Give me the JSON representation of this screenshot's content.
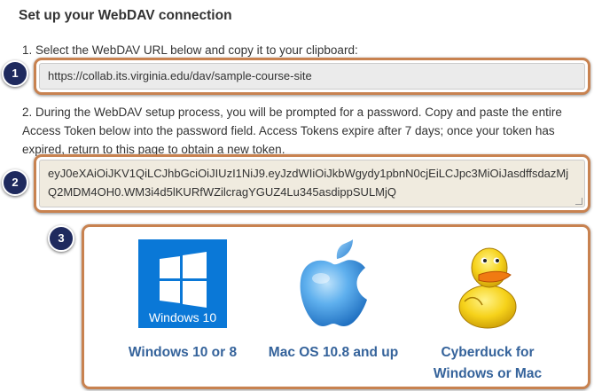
{
  "heading": "Set up your WebDAV connection",
  "step1": {
    "text": "1. Select the WebDAV URL below and copy it to your clipboard:",
    "url_value": "https://collab.its.virginia.edu/dav/sample-course-site"
  },
  "step2": {
    "text": "2. During the WebDAV setup process, you will be prompted for a password. Copy and paste the entire Access Token below into the password field. Access Tokens expire after 7 days; once your token has expired, return to this page to obtain a new token.",
    "token_value": "eyJ0eXAiOiJKV1QiLCJhbGciOiJIUzI1NiJ9.eyJzdWIiOiJkbWgydy1pbnN0cjEiLCJpc3MiOiJasdffsdazMjQ2MDM4OH0.WM3i4d5lKURfWZilcragYGUZ4Lu345asdippSULMjQ"
  },
  "badges": [
    "1",
    "2",
    "3"
  ],
  "os_options": [
    {
      "label": "Windows 10 or 8",
      "logo_text": "Windows 10",
      "icon": "windows-logo-icon"
    },
    {
      "label": "Mac OS 10.8 and up",
      "icon": "apple-logo-icon"
    },
    {
      "label": "Cyberduck for Windows or Mac",
      "icon": "cyberduck-logo-icon"
    }
  ],
  "colors": {
    "frame": "#c88250",
    "badge": "#1f2a5e",
    "link": "#35639b",
    "windows_blue": "#0a78d7"
  }
}
